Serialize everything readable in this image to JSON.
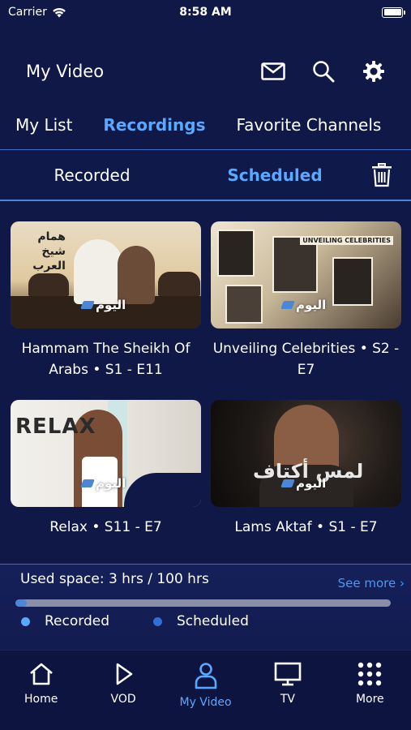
{
  "status": {
    "carrier": "Carrier",
    "time": "8:58 AM"
  },
  "header": {
    "title": "My Video"
  },
  "tabs": [
    {
      "label": "My List"
    },
    {
      "label": "Recordings"
    },
    {
      "label": "Favorite Channels"
    }
  ],
  "subtabs": {
    "recorded": "Recorded",
    "scheduled": "Scheduled"
  },
  "cards": [
    {
      "title": "Hammam The Sheikh Of Arabs • S1 - E11",
      "thumb_text": "همام شيخ العرب",
      "logo": "اليوم"
    },
    {
      "title": "Unveiling Celebrities • S2 - E7",
      "thumb_text": "UNVEILING CELEBRITIES",
      "logo": "اليوم"
    },
    {
      "title": "Relax • S11 - E7",
      "thumb_text": "RELAX",
      "logo": "اليوم"
    },
    {
      "title": "Lams Aktaf • S1 - E7",
      "thumb_text": "لمس أكتاف",
      "logo": "اليوم"
    }
  ],
  "storage": {
    "used_text": "Used space: 3 hrs / 100 hrs",
    "see_more": "See more ›",
    "used_fraction": 0.03,
    "legend_recorded": "Recorded",
    "legend_scheduled": "Scheduled"
  },
  "nav": [
    {
      "label": "Home",
      "icon": "home-icon"
    },
    {
      "label": "VOD",
      "icon": "play-icon"
    },
    {
      "label": "My Video",
      "icon": "user-icon"
    },
    {
      "label": "TV",
      "icon": "tv-icon"
    },
    {
      "label": "More",
      "icon": "grid-icon"
    }
  ],
  "colors": {
    "background": "#101847",
    "accent": "#5aa8ff",
    "recorded_dot": "#5aa8ff",
    "scheduled_dot": "#2f6fd8"
  }
}
